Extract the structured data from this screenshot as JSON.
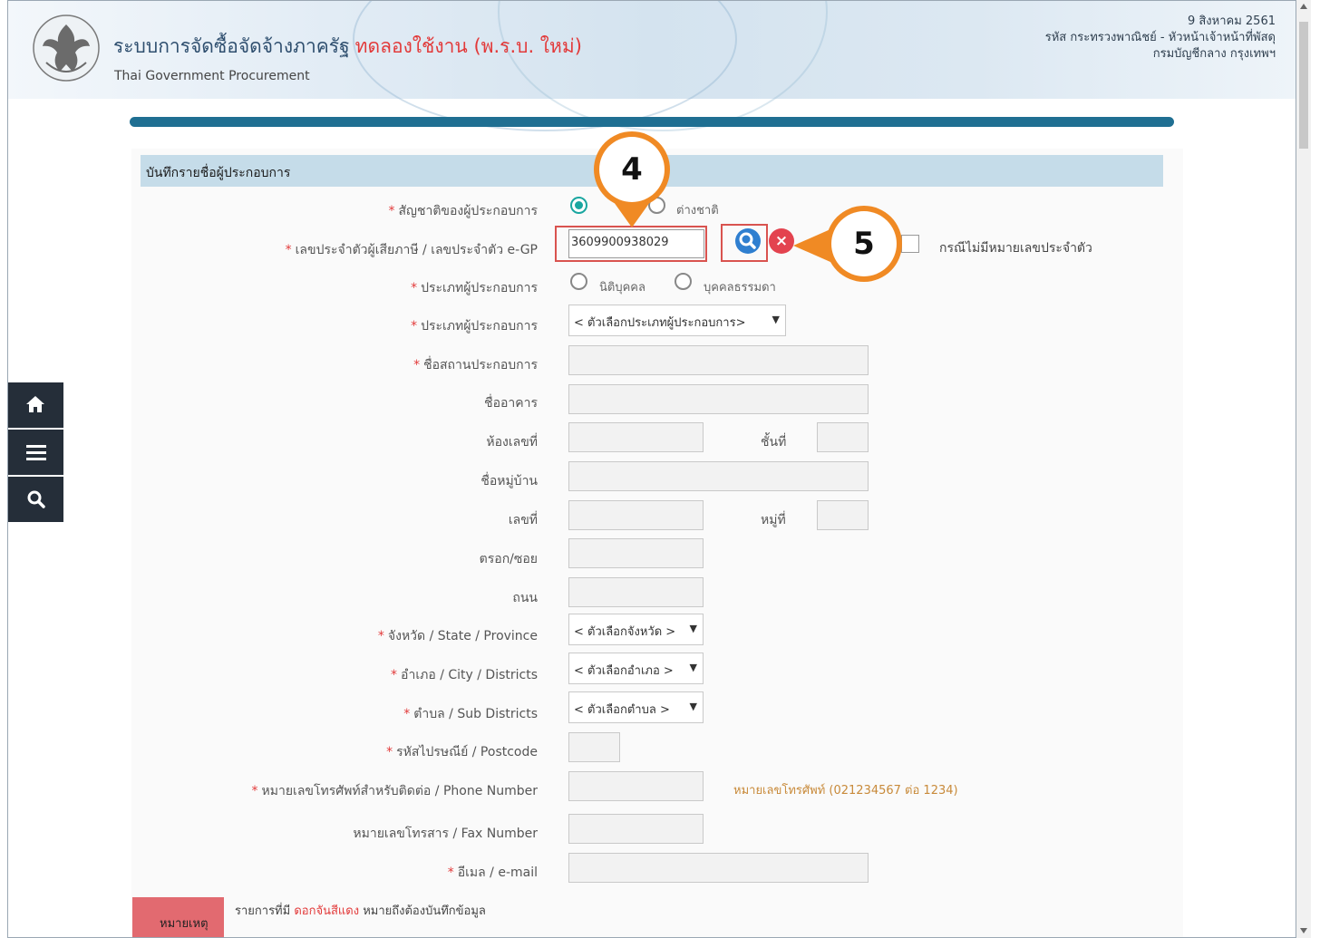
{
  "header": {
    "title": "ระบบการจัดซื้อจัดจ้างภาครัฐ",
    "title_trial": "ทดลองใช้งาน (พ.ร.บ. ใหม่)",
    "subtitle": "Thai Government Procurement",
    "date": "9 สิงหาคม 2561",
    "user_line1": "รหัส กระทรวงพาณิชย์ - หัวหน้าเจ้าหน้าที่พัสดุ",
    "user_line2": "กรมบัญชีกลาง กรุงเทพฯ",
    "logo_icon": "garuda-emblem-icon"
  },
  "section_title": "บันทึกรายชื่อผู้ประกอบการ",
  "required_mark": "*",
  "form": {
    "nationality_label": "สัญชาติของผู้ประกอบการ",
    "nationality_foreign": "ต่างชาติ",
    "taxid_label": "เลขประจำตัวผู้เสียภาษี / เลขประจำตัว e-GP",
    "taxid_value": "3609900938029",
    "no_id_label": "กรณีไม่มีหมายเลขประจำตัว",
    "type_label": "ประเภทผู้ประกอบการ",
    "type_juristic": "นิติบุคคล",
    "type_individual": "บุคคลธรรมดา",
    "type2_label": "ประเภทผู้ประกอบการ",
    "type2_select": "< ตัวเลือกประเภทผู้ประกอบการ>",
    "business_name_label": "ชื่อสถานประกอบการ",
    "building_label": "ชื่ออาคาร",
    "room_label": "ห้องเลขที่",
    "floor_label": "ชั้นที่",
    "village_label": "ชื่อหมู่บ้าน",
    "house_no_label": "เลขที่",
    "moo_label": "หมู่ที่",
    "alley_label": "ตรอก/ซอย",
    "road_label": "ถนน",
    "province_label": "จังหวัด / State / Province",
    "province_select": "< ตัวเลือกจังหวัด >",
    "district_label": "อำเภอ / City / Districts",
    "district_select": "< ตัวเลือกอำเภอ >",
    "subdistrict_label": "ตำบล / Sub Districts",
    "subdistrict_select": "< ตัวเลือกตำบล >",
    "postcode_label": "รหัสไปรษณีย์ / Postcode",
    "phone_label": "หมายเลขโทรศัพท์สำหรับติดต่อ / Phone Number",
    "phone_hint": "หมายเลขโทรศัพท์ (021234567 ต่อ 1234)",
    "fax_label": "หมายเลขโทรสาร / Fax Number",
    "email_label": "อีเมล / e-mail"
  },
  "callouts": {
    "step4": "4",
    "step5": "5"
  },
  "note": {
    "button": "หมายเหตุ",
    "text_prefix": "รายการที่มี",
    "text_red": "ดอกจันสีแดง",
    "text_suffix": "หมายถึงต้องบันทึกข้อมูล"
  },
  "sidebar": {
    "icons": [
      "home-icon",
      "menu-icon",
      "search-icon"
    ]
  },
  "colors": {
    "accent_bar": "#1f6f92",
    "section_bg": "#c5dce9",
    "required": "#e23a3a",
    "callout": "#f08a24",
    "sidebar": "#252e39"
  }
}
